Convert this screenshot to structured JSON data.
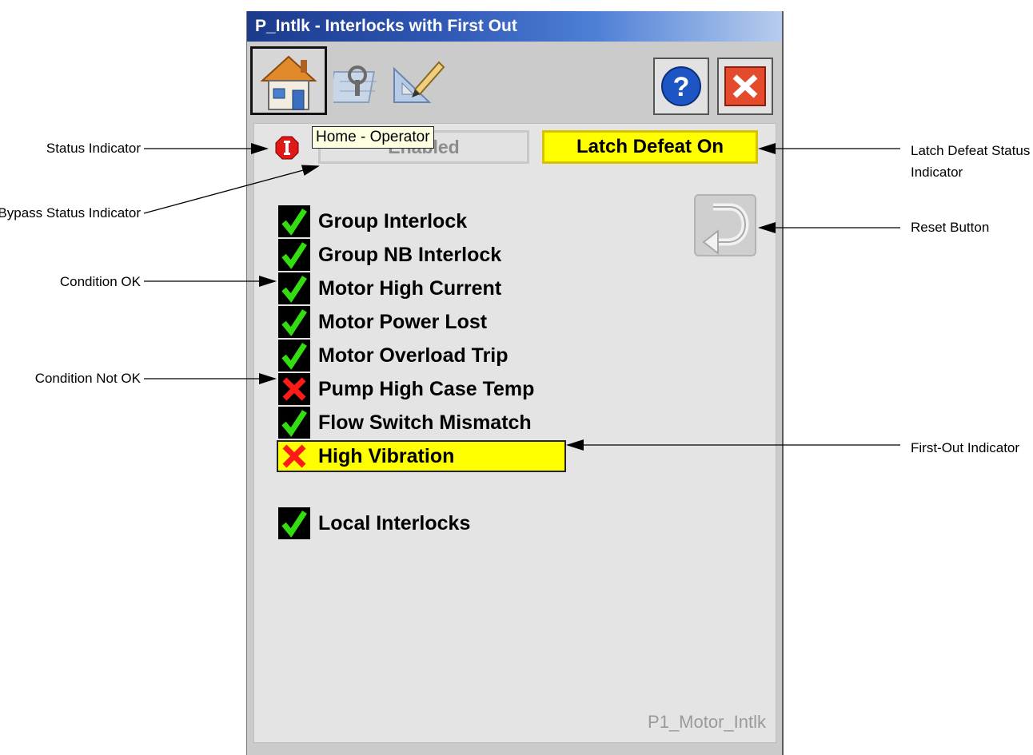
{
  "window": {
    "title": "P_Intlk - Interlocks with First Out",
    "tooltip": "Home - Operator",
    "tag_name": "P1_Motor_Intlk"
  },
  "toolbar": {
    "tabs": [
      {
        "icon": "home-icon",
        "label": "Home - Operator",
        "selected": true
      },
      {
        "icon": "maintenance-icon"
      },
      {
        "icon": "engineering-icon"
      }
    ],
    "help_icon": "help-icon",
    "close_icon": "close-icon"
  },
  "status": {
    "status_indicator_icon": "alarm-i-icon",
    "bypass_text": "Enabled",
    "latch_defeat_text": "Latch Defeat On",
    "latch_color": "#ffff00"
  },
  "interlocks": [
    {
      "label": "Group Interlock",
      "ok": true,
      "first_out": false
    },
    {
      "label": "Group NB Interlock",
      "ok": true,
      "first_out": false
    },
    {
      "label": "Motor High Current",
      "ok": true,
      "first_out": false
    },
    {
      "label": "Motor Power Lost",
      "ok": true,
      "first_out": false
    },
    {
      "label": "Motor Overload Trip",
      "ok": true,
      "first_out": false
    },
    {
      "label": "Pump High Case Temp",
      "ok": false,
      "first_out": false
    },
    {
      "label": "Flow Switch Mismatch",
      "ok": true,
      "first_out": false
    },
    {
      "label": "High Vibration",
      "ok": false,
      "first_out": true
    }
  ],
  "local_interlocks": {
    "label": "Local Interlocks",
    "ok": true
  },
  "reset_button_icon": "reset-arrow-icon",
  "callouts": {
    "status_indicator": "Status Indicator",
    "bypass_status": "Bypass Status Indicator",
    "condition_ok": "Condition OK",
    "condition_not_ok": "Condition Not OK",
    "latch_defeat_status": "Latch Defeat Status Indicator",
    "reset_button": "Reset Button",
    "first_out": "First-Out Indicator"
  }
}
